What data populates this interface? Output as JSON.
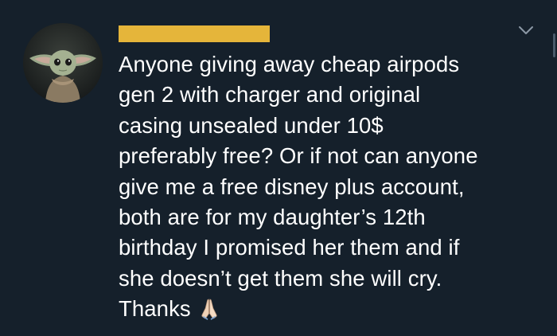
{
  "tweet": {
    "text_lines": [
      "Anyone giving away cheap airpods",
      "gen 2 with charger and original",
      "casing unsealed under 10$",
      "preferably free? Or if not can anyone",
      "give me a free disney plus account,",
      "both are for my daughter’s 12th",
      "birthday I promised her them and if",
      "she doesn’t get them she will cry.",
      "Thanks"
    ],
    "emoji": "folded-hands-emoji",
    "avatar_icon": "baby-yoda-avatar-icon",
    "menu_icon": "chevron-down-icon"
  },
  "colors": {
    "background": "#15202b",
    "text": "#ffffff",
    "name_redaction": "#e5b53a",
    "chevron": "#8b98a5"
  }
}
